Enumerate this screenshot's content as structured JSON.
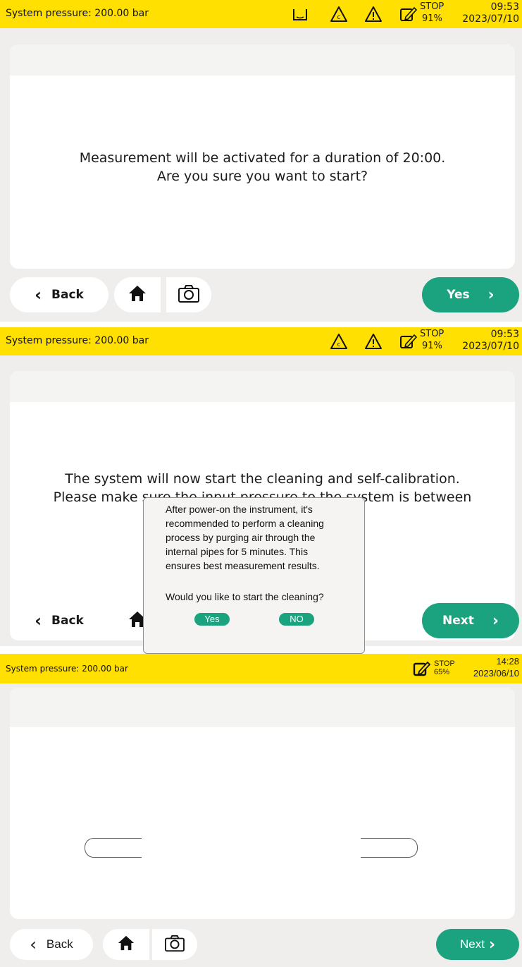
{
  "screens": [
    {
      "pressure": "System pressure: 200.00 bar",
      "stop_label": "STOP",
      "stop_percent": "91%",
      "time": "09:53",
      "date": "2023/07/10",
      "icons": [
        "bath-icon",
        "warning-c-icon",
        "warning-icon",
        "edit-icon"
      ],
      "message": "Measurement will be activated for a duration of 20:00.\nAre you sure you want to start?",
      "back_label": "Back",
      "primary_label": "Yes"
    },
    {
      "pressure": "System pressure: 200.00 bar",
      "stop_label": "STOP",
      "stop_percent": "91%",
      "time": "09:53",
      "date": "2023/07/10",
      "icons": [
        "warning-c-icon",
        "warning-icon",
        "edit-icon"
      ],
      "message": "The system will now start the cleaning and self-calibration.\nPlease make sure the input pressure to the system is between\n4...15bar(g).",
      "back_label": "Back",
      "primary_label": "Next"
    },
    {
      "pressure": "System pressure: 200.00 bar",
      "stop_label": "STOP",
      "stop_percent": "65%",
      "time": "14:28",
      "date": "2023/06/10",
      "icons": [
        "edit-icon"
      ],
      "dialog": {
        "text": "After power-on the instrument, it's\nrecommended to perform a cleaning\nprocess by purging air through the\ninternal pipes for 5 minutes. This\nensures best measurement results.",
        "question": "Would you like to start the cleaning?",
        "yes_label": "Yes",
        "no_label": "NO"
      },
      "back_label": "Back",
      "primary_label": "Next"
    }
  ],
  "colors": {
    "status_bar": "#ffe000",
    "accent": "#1aa37e",
    "background": "#efeeec"
  }
}
